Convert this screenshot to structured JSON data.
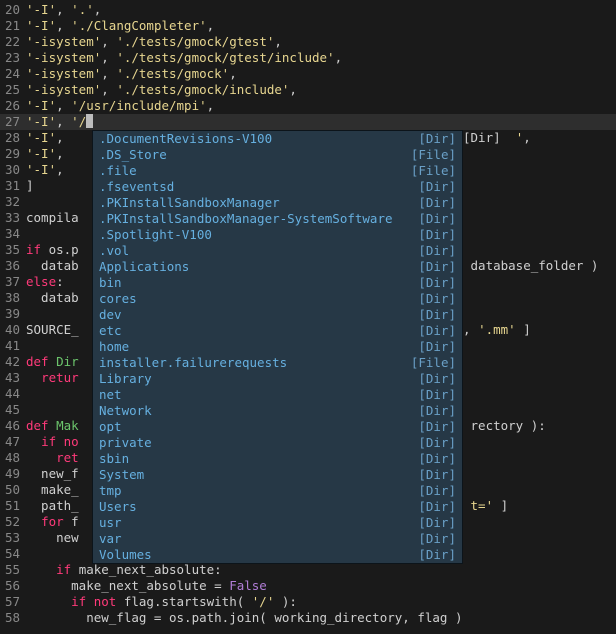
{
  "gutter_start": 20,
  "lines": [
    {
      "n": 20,
      "tokens": [
        {
          "t": "'-I'",
          "c": "str"
        },
        {
          "t": ", ",
          "c": "id"
        },
        {
          "t": "'.'",
          "c": "str"
        },
        {
          "t": ",",
          "c": "id"
        }
      ]
    },
    {
      "n": 21,
      "tokens": [
        {
          "t": "'-I'",
          "c": "str"
        },
        {
          "t": ", ",
          "c": "id"
        },
        {
          "t": "'./ClangCompleter'",
          "c": "str"
        },
        {
          "t": ",",
          "c": "id"
        }
      ]
    },
    {
      "n": 22,
      "tokens": [
        {
          "t": "'-isystem'",
          "c": "str"
        },
        {
          "t": ", ",
          "c": "id"
        },
        {
          "t": "'./tests/gmock/gtest'",
          "c": "str"
        },
        {
          "t": ",",
          "c": "id"
        }
      ]
    },
    {
      "n": 23,
      "tokens": [
        {
          "t": "'-isystem'",
          "c": "str"
        },
        {
          "t": ", ",
          "c": "id"
        },
        {
          "t": "'./tests/gmock/gtest/include'",
          "c": "str"
        },
        {
          "t": ",",
          "c": "id"
        }
      ]
    },
    {
      "n": 24,
      "tokens": [
        {
          "t": "'-isystem'",
          "c": "str"
        },
        {
          "t": ", ",
          "c": "id"
        },
        {
          "t": "'./tests/gmock'",
          "c": "str"
        },
        {
          "t": ",",
          "c": "id"
        }
      ]
    },
    {
      "n": 25,
      "tokens": [
        {
          "t": "'-isystem'",
          "c": "str"
        },
        {
          "t": ", ",
          "c": "id"
        },
        {
          "t": "'./tests/gmock/include'",
          "c": "str"
        },
        {
          "t": ",",
          "c": "id"
        }
      ]
    },
    {
      "n": 26,
      "tokens": [
        {
          "t": "'-I'",
          "c": "str"
        },
        {
          "t": ", ",
          "c": "id"
        },
        {
          "t": "'/usr/include/mpi'",
          "c": "str"
        },
        {
          "t": ",",
          "c": "id"
        }
      ]
    },
    {
      "n": 27,
      "current": true,
      "tokens": [
        {
          "t": "'-I'",
          "c": "str"
        },
        {
          "t": ", ",
          "c": "id"
        },
        {
          "t": "'/",
          "c": "str"
        },
        {
          "cursor": true
        }
      ]
    },
    {
      "n": 28,
      "left": "'-I', ",
      "right": "[Dir]  ',"
    },
    {
      "n": 29,
      "left": "'-I', "
    },
    {
      "n": 30,
      "left": "'-I', "
    },
    {
      "n": 31,
      "left": "]"
    },
    {
      "n": 32,
      "left": ""
    },
    {
      "n": 33,
      "left": "compila"
    },
    {
      "n": 34,
      "left": ""
    },
    {
      "n": 35,
      "tokens": [
        {
          "t": "if",
          "c": "kw"
        },
        {
          "t": " os.p",
          "c": "id"
        }
      ]
    },
    {
      "n": 36,
      "tokens": [
        {
          "t": "  datab",
          "c": "id"
        }
      ],
      "right": " database_folder )"
    },
    {
      "n": 37,
      "tokens": [
        {
          "t": "else",
          "c": "kw"
        },
        {
          "t": ":",
          "c": "id"
        }
      ]
    },
    {
      "n": 38,
      "tokens": [
        {
          "t": "  datab",
          "c": "id"
        }
      ]
    },
    {
      "n": 39,
      "left": ""
    },
    {
      "n": 40,
      "tokens": [
        {
          "t": "SOURCE_",
          "c": "id"
        }
      ],
      "right": ", '.mm' ]"
    },
    {
      "n": 41,
      "left": ""
    },
    {
      "n": 42,
      "tokens": [
        {
          "t": "def",
          "c": "kw"
        },
        {
          "t": " ",
          "c": "id"
        },
        {
          "t": "Dir",
          "c": "def"
        }
      ]
    },
    {
      "n": 43,
      "tokens": [
        {
          "t": "  ",
          "c": "id"
        },
        {
          "t": "retur",
          "c": "kw"
        }
      ]
    },
    {
      "n": 44,
      "left": ""
    },
    {
      "n": 45,
      "left": ""
    },
    {
      "n": 46,
      "tokens": [
        {
          "t": "def",
          "c": "kw"
        },
        {
          "t": " ",
          "c": "id"
        },
        {
          "t": "Mak",
          "c": "def"
        }
      ],
      "right": " rectory ):"
    },
    {
      "n": 47,
      "tokens": [
        {
          "t": "  ",
          "c": "id"
        },
        {
          "t": "if",
          "c": "kw"
        },
        {
          "t": " ",
          "c": "id"
        },
        {
          "t": "no",
          "c": "kw"
        }
      ]
    },
    {
      "n": 48,
      "tokens": [
        {
          "t": "    ",
          "c": "id"
        },
        {
          "t": "ret",
          "c": "kw"
        }
      ]
    },
    {
      "n": 49,
      "tokens": [
        {
          "t": "  new_f",
          "c": "id"
        }
      ]
    },
    {
      "n": 50,
      "tokens": [
        {
          "t": "  make_",
          "c": "id"
        }
      ]
    },
    {
      "n": 51,
      "tokens": [
        {
          "t": "  path_",
          "c": "id"
        }
      ],
      "right": " t=' ]"
    },
    {
      "n": 52,
      "tokens": [
        {
          "t": "  ",
          "c": "id"
        },
        {
          "t": "for",
          "c": "kw"
        },
        {
          "t": " f",
          "c": "id"
        }
      ]
    },
    {
      "n": 53,
      "tokens": [
        {
          "t": "    new",
          "c": "id"
        }
      ]
    },
    {
      "n": 54,
      "left": ""
    },
    {
      "n": 55,
      "tokens": [
        {
          "t": "    ",
          "c": "id"
        },
        {
          "t": "if",
          "c": "kw"
        },
        {
          "t": " make_next_absolute:",
          "c": "id"
        }
      ]
    },
    {
      "n": 56,
      "tokens": [
        {
          "t": "      make_next_absolute = ",
          "c": "id"
        },
        {
          "t": "False",
          "c": "const"
        }
      ]
    },
    {
      "n": 57,
      "tokens": [
        {
          "t": "      ",
          "c": "id"
        },
        {
          "t": "if not",
          "c": "kw"
        },
        {
          "t": " flag.startswith( ",
          "c": "id"
        },
        {
          "t": "'/'",
          "c": "str"
        },
        {
          "t": " ):",
          "c": "id"
        }
      ]
    },
    {
      "n": 58,
      "tokens": [
        {
          "t": "        new_flag = os.path.join( working_directory, flag )",
          "c": "id"
        }
      ]
    }
  ],
  "popup": {
    "items": [
      {
        "label": ".DocumentRevisions-V100",
        "kind": "[Dir]"
      },
      {
        "label": ".DS_Store",
        "kind": "[File]"
      },
      {
        "label": ".file",
        "kind": "[File]"
      },
      {
        "label": ".fseventsd",
        "kind": "[Dir]"
      },
      {
        "label": ".PKInstallSandboxManager",
        "kind": "[Dir]"
      },
      {
        "label": ".PKInstallSandboxManager-SystemSoftware",
        "kind": "[Dir]"
      },
      {
        "label": ".Spotlight-V100",
        "kind": "[Dir]"
      },
      {
        "label": ".vol",
        "kind": "[Dir]"
      },
      {
        "label": "Applications",
        "kind": "[Dir]"
      },
      {
        "label": "bin",
        "kind": "[Dir]"
      },
      {
        "label": "cores",
        "kind": "[Dir]"
      },
      {
        "label": "dev",
        "kind": "[Dir]"
      },
      {
        "label": "etc",
        "kind": "[Dir]"
      },
      {
        "label": "home",
        "kind": "[Dir]"
      },
      {
        "label": "installer.failurerequests",
        "kind": "[File]"
      },
      {
        "label": "Library",
        "kind": "[Dir]"
      },
      {
        "label": "net",
        "kind": "[Dir]"
      },
      {
        "label": "Network",
        "kind": "[Dir]"
      },
      {
        "label": "opt",
        "kind": "[Dir]"
      },
      {
        "label": "private",
        "kind": "[Dir]"
      },
      {
        "label": "sbin",
        "kind": "[Dir]"
      },
      {
        "label": "System",
        "kind": "[Dir]"
      },
      {
        "label": "tmp",
        "kind": "[Dir]"
      },
      {
        "label": "Users",
        "kind": "[Dir]"
      },
      {
        "label": "usr",
        "kind": "[Dir]"
      },
      {
        "label": "var",
        "kind": "[Dir]"
      },
      {
        "label": "Volumes",
        "kind": "[Dir]"
      }
    ]
  },
  "right_fragments": [
    {
      "line": 28,
      "text": "[Dir]  ',"
    },
    {
      "line": 36,
      "text": " database_folder )"
    },
    {
      "line": 40,
      "text": ", '.mm' ]"
    },
    {
      "line": 46,
      "text": " rectory ):"
    },
    {
      "line": 51,
      "text": " t=' ]"
    }
  ]
}
